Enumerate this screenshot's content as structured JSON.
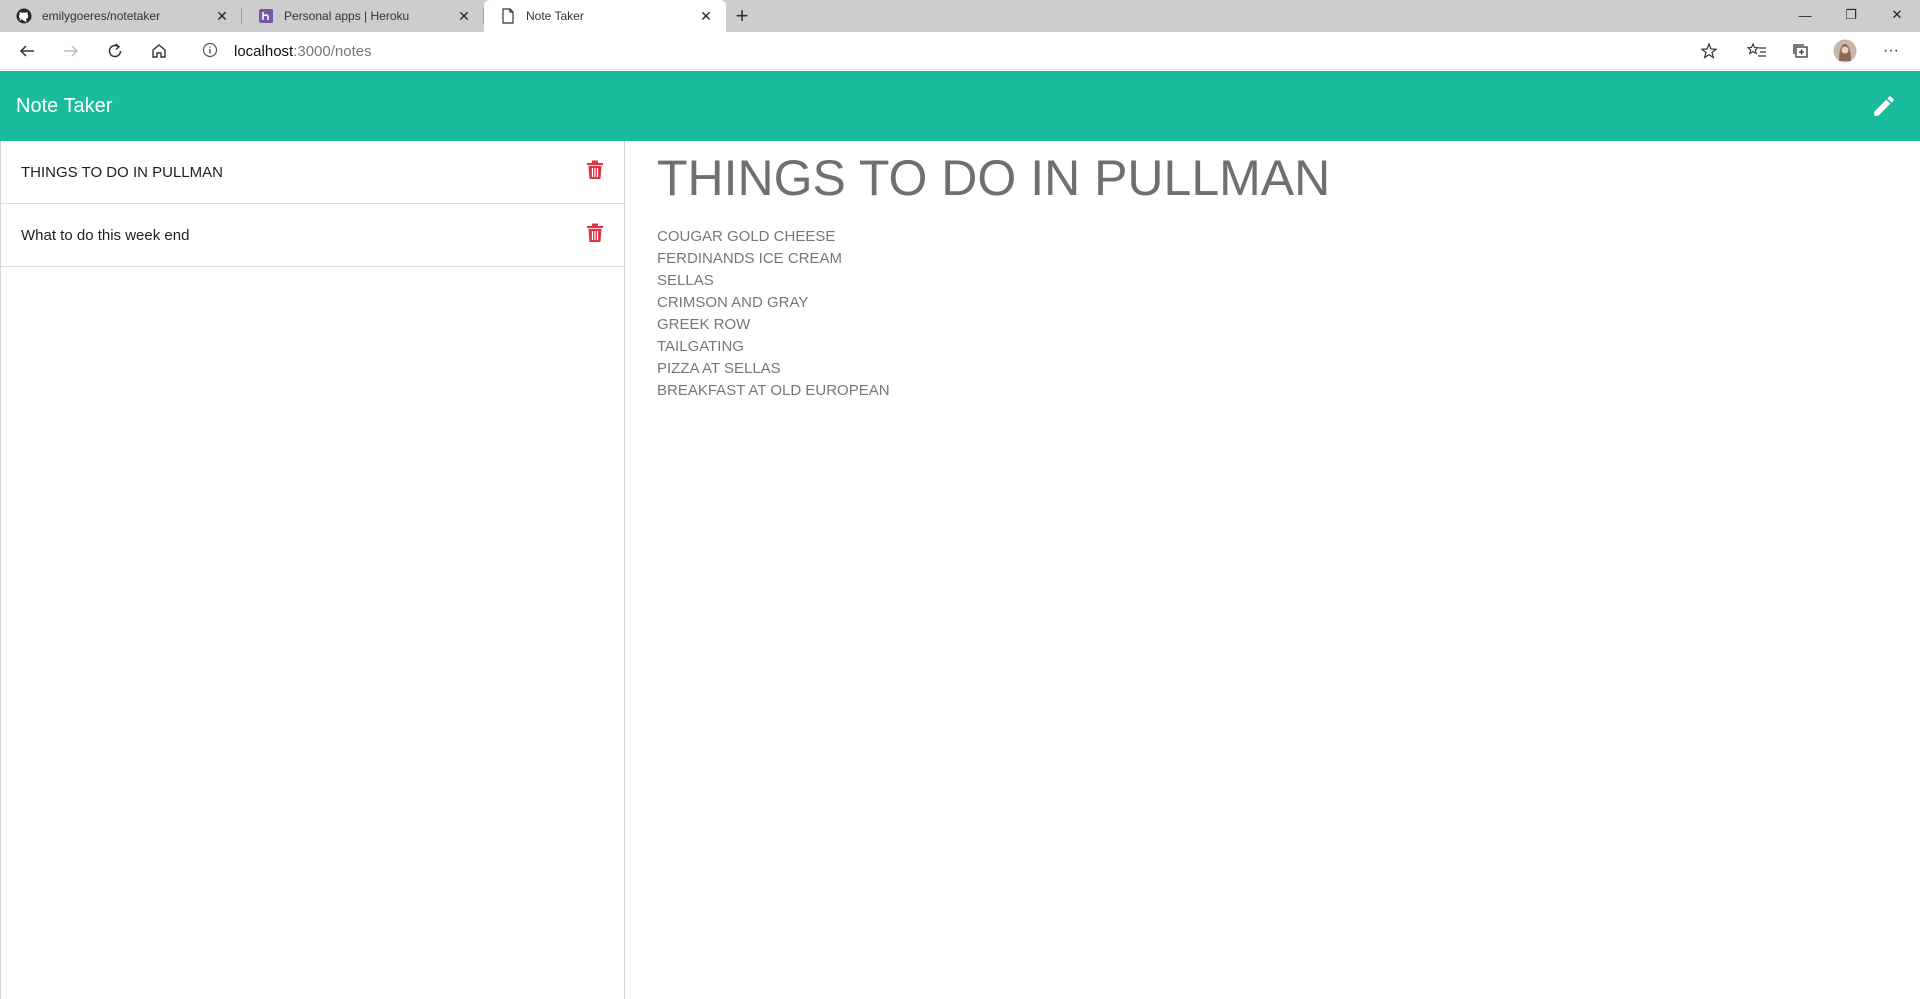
{
  "browser": {
    "tabs": [
      {
        "title": "emilygoeres/notetaker",
        "icon": "github-icon",
        "active": false
      },
      {
        "title": "Personal apps | Heroku",
        "icon": "heroku-icon",
        "active": false
      },
      {
        "title": "Note Taker",
        "icon": "page-icon",
        "active": true
      }
    ],
    "url_host": "localhost",
    "url_path": ":3000/notes"
  },
  "app": {
    "brand": "Note Taker",
    "accent_color": "#1abc9c",
    "delete_color": "#dc3545"
  },
  "notes": [
    {
      "title": "THINGS TO DO IN PULLMAN"
    },
    {
      "title": "What to do this week end"
    }
  ],
  "active_note": {
    "title": "THINGS TO DO IN PULLMAN",
    "lines": [
      "COUGAR GOLD CHEESE",
      "FERDINANDS ICE CREAM",
      "SELLAS",
      "CRIMSON AND GRAY",
      "GREEK ROW",
      "TAILGATING",
      "PIZZA AT SELLAS",
      "BREAKFAST AT OLD EUROPEAN"
    ]
  }
}
